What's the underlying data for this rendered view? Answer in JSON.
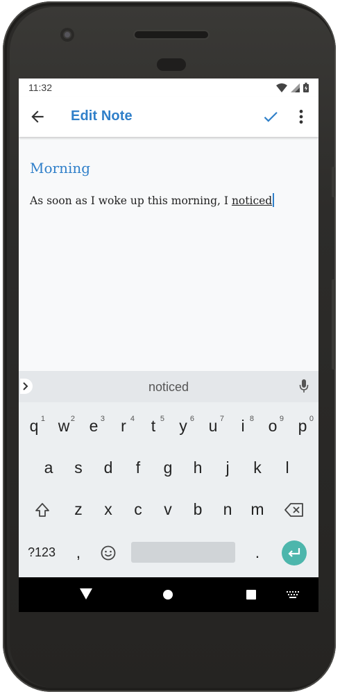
{
  "status": {
    "time": "11:32"
  },
  "appbar": {
    "title": "Edit Note"
  },
  "note": {
    "title": "Morning",
    "body_prefix": "As soon as I woke up this morning, I ",
    "body_last_word": "noticed"
  },
  "keyboard": {
    "suggestion": "noticed",
    "row1": [
      "q",
      "w",
      "e",
      "r",
      "t",
      "y",
      "u",
      "i",
      "o",
      "p"
    ],
    "row1_hints": [
      "1",
      "2",
      "3",
      "4",
      "5",
      "6",
      "7",
      "8",
      "9",
      "0"
    ],
    "row2": [
      "a",
      "s",
      "d",
      "f",
      "g",
      "h",
      "j",
      "k",
      "l"
    ],
    "row3": [
      "z",
      "x",
      "c",
      "v",
      "b",
      "n",
      "m"
    ],
    "symbols_label": "?123",
    "comma_label": ",",
    "period_label": "."
  },
  "colors": {
    "accent": "#2f7fc9",
    "enter": "#4db6ac"
  }
}
